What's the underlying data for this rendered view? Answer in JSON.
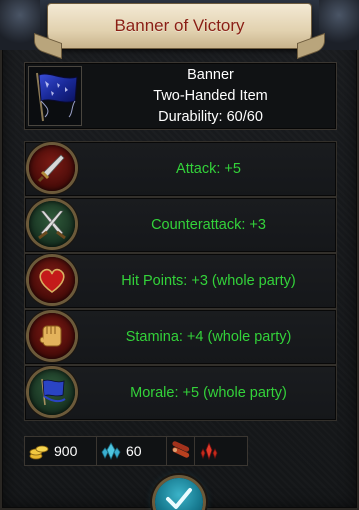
{
  "title": "Banner of Victory",
  "item": {
    "icon": "blue-banner-icon",
    "type": "Banner",
    "slot": "Two-Handed Item",
    "durability": "Durability: 60/60"
  },
  "stats": [
    {
      "icon": "sword-icon",
      "text": "Attack: +5"
    },
    {
      "icon": "crossed-swords-icon",
      "text": "Counterattack: +3"
    },
    {
      "icon": "heart-icon",
      "text": "Hit Points: +3 (whole party)"
    },
    {
      "icon": "fist-icon",
      "text": "Stamina: +4 (whole party)"
    },
    {
      "icon": "blue-banner-icon",
      "text": "Morale: +5 (whole party)"
    }
  ],
  "resources": [
    {
      "icon": "gold-coins-icon",
      "value": "900"
    },
    {
      "icon": "blue-crystal-icon",
      "value": "60"
    },
    {
      "icon": "wood-logs-icon",
      "value": ""
    },
    {
      "icon": "red-crystal-icon",
      "value": ""
    }
  ],
  "confirm": {
    "icon": "checkmark-icon"
  },
  "colors": {
    "title_text": "#8a1f14",
    "stat_text": "#33d23a",
    "info_text": "#ffffff",
    "frame_gold": "#6c5a3a"
  }
}
